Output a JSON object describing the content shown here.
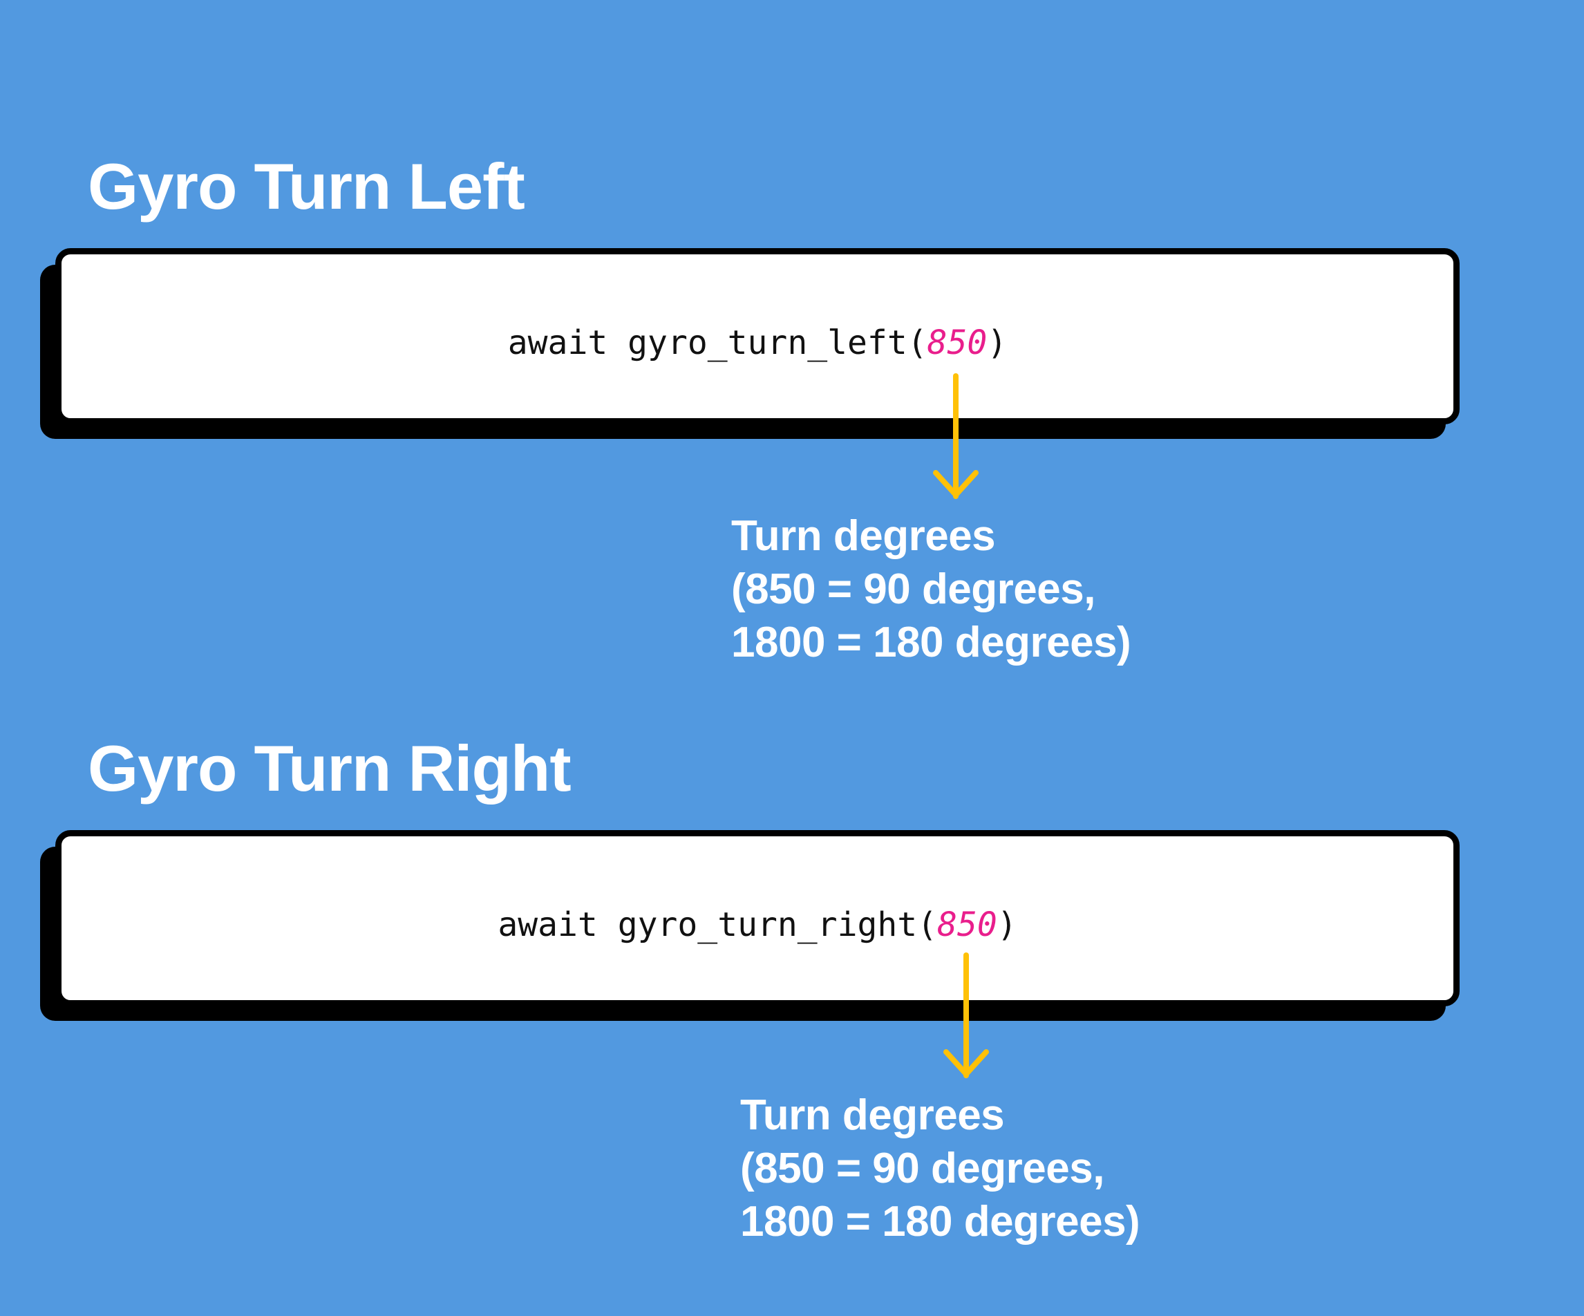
{
  "background_color": "#5299E0",
  "accent_color": "#FFC107",
  "argument_color": "#E91E8C",
  "sections": [
    {
      "heading": "Gyro Turn Left",
      "code": {
        "prefix": "await gyro_turn_left(",
        "argument": "850",
        "suffix": ")"
      },
      "note": {
        "line1": "Turn degrees",
        "line2": "(850 = 90 degrees,",
        "line3": "1800 = 180 degrees)"
      }
    },
    {
      "heading": "Gyro Turn Right",
      "code": {
        "prefix": "await gyro_turn_right(",
        "argument": "850",
        "suffix": ")"
      },
      "note": {
        "line1": "Turn degrees",
        "line2": "(850 = 90 degrees,",
        "line3": "1800 = 180 degrees)"
      }
    }
  ]
}
